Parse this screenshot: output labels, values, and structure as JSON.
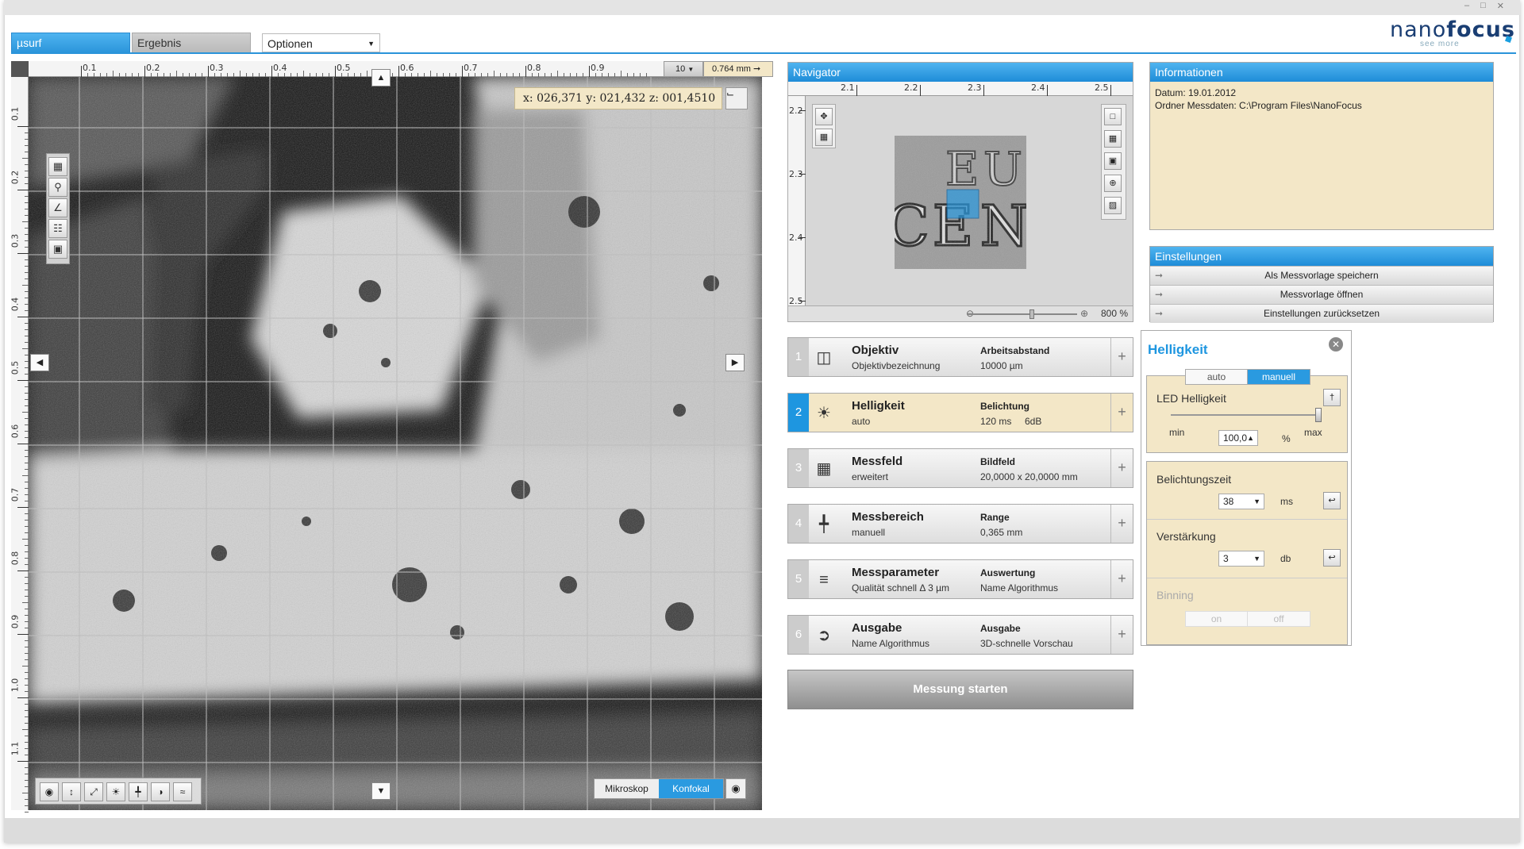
{
  "tabs": {
    "usurf": "µsurf",
    "ergebnis": "Ergebnis",
    "optionen": "Optionen"
  },
  "logo": {
    "part1": "nano",
    "part2": "focus",
    "tagline": "see more"
  },
  "viewer": {
    "ruler_x": [
      "0.1",
      "0.2",
      "0.3",
      "0.4",
      "0.5",
      "0.6",
      "0.7",
      "0.8",
      "0.9"
    ],
    "ruler_y": [
      "0.1",
      "0.2",
      "0.3",
      "0.4",
      "0.5",
      "0.6",
      "0.7",
      "0.8",
      "0.9",
      "1.0",
      "1.1"
    ],
    "zoom_value": "10",
    "scale_value": "0.764 mm",
    "coord_readout": "x: 026,371  y: 021,432  z: 001,4510",
    "mode_microscope": "Mikroskop",
    "mode_confocal": "Konfokal",
    "active_mode": "Konfokal"
  },
  "navigator": {
    "title": "Navigator",
    "ruler_x": [
      "2.1",
      "2.2",
      "2.3",
      "2.4",
      "2.5"
    ],
    "ruler_y": [
      "2.2",
      "2.3",
      "2.4",
      "2.5"
    ],
    "zoom_percent": "800 %"
  },
  "steps": [
    {
      "num": "1",
      "title": "Objektiv",
      "subtitle": "Objektivbezeichnung",
      "label": "Arbeitsabstand",
      "value": "10000 µm",
      "value2": "",
      "active": false
    },
    {
      "num": "2",
      "title": "Helligkeit",
      "subtitle": "auto",
      "label": "Belichtung",
      "value": "120 ms",
      "value2": "6dB",
      "active": true
    },
    {
      "num": "3",
      "title": "Messfeld",
      "subtitle": "erweitert",
      "label": "Bildfeld",
      "value": "20,0000 x 20,0000 mm",
      "value2": "",
      "active": false
    },
    {
      "num": "4",
      "title": "Messbereich",
      "subtitle": "manuell",
      "label": "Range",
      "value": "0,365 mm",
      "value2": "",
      "active": false
    },
    {
      "num": "5",
      "title": "Messparameter",
      "subtitle": "Qualität schnell  Δ 3 µm",
      "label": "Auswertung",
      "value": "Name Algorithmus",
      "value2": "",
      "active": false
    },
    {
      "num": "6",
      "title": "Ausgabe",
      "subtitle": "Name Algorithmus",
      "label": "Ausgabe",
      "value": "3D-schnelle Vorschau",
      "value2": "",
      "active": false
    }
  ],
  "start_button": "Messung starten",
  "info": {
    "title": "Informationen",
    "date": "Datum: 19.01.2012",
    "folder": "Ordner Messdaten: C:\\Program Files\\NanoFocus"
  },
  "settings": {
    "title": "Einstellungen",
    "items": [
      "Als Messvorlage speichern",
      "Messvorlage öffnen",
      "Einstellungen zurücksetzen"
    ]
  },
  "brightness": {
    "title": "Helligkeit",
    "mode_auto": "auto",
    "mode_manual": "manuell",
    "active_mode": "manuell",
    "led_label": "LED Helligkeit",
    "led_min": "min",
    "led_max": "max",
    "led_value": "100,0",
    "led_unit": "%",
    "led_level": 1.0,
    "exposure_label": "Belichtungszeit",
    "exposure_value": "38",
    "exposure_unit": "ms",
    "gain_label": "Verstärkung",
    "gain_value": "3",
    "gain_unit": "db",
    "binning_label": "Binning",
    "binning_on": "on",
    "binning_off": "off"
  },
  "colors": {
    "accent": "#1e96e0",
    "panel_yellow": "#f3e7c7"
  }
}
